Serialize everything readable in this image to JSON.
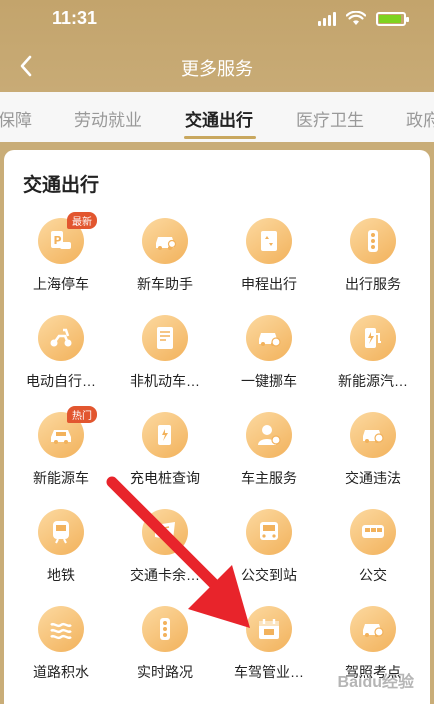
{
  "status_bar": {
    "time": "11:31"
  },
  "header": {
    "title": "更多服务"
  },
  "tabs": [
    {
      "label": "保障",
      "active": false
    },
    {
      "label": "劳动就业",
      "active": false
    },
    {
      "label": "交通出行",
      "active": true
    },
    {
      "label": "医疗卫生",
      "active": false
    },
    {
      "label": "政府",
      "active": false
    }
  ],
  "section": {
    "title": "交通出行"
  },
  "services": [
    {
      "label": "上海停车",
      "icon": "parking-car-icon",
      "badge": "最新"
    },
    {
      "label": "新车助手",
      "icon": "new-car-icon"
    },
    {
      "label": "申程出行",
      "icon": "elevator-icon"
    },
    {
      "label": "出行服务",
      "icon": "traffic-light-icon"
    },
    {
      "label": "电动自行…",
      "icon": "e-scooter-icon"
    },
    {
      "label": "非机动车…",
      "icon": "document-icon"
    },
    {
      "label": "一键挪车",
      "icon": "car-move-icon"
    },
    {
      "label": "新能源汽…",
      "icon": "ev-charge-icon"
    },
    {
      "label": "新能源车",
      "icon": "car-icon",
      "badge": "热门"
    },
    {
      "label": "充电桩查询",
      "icon": "charging-pile-icon"
    },
    {
      "label": "车主服务",
      "icon": "car-owner-icon"
    },
    {
      "label": "交通违法",
      "icon": "violation-car-icon"
    },
    {
      "label": "地铁",
      "icon": "metro-icon"
    },
    {
      "label": "交通卡余…",
      "icon": "card-icon"
    },
    {
      "label": "公交到站",
      "icon": "bus-stop-icon"
    },
    {
      "label": "公交",
      "icon": "bus-icon"
    },
    {
      "label": "道路积水",
      "icon": "water-icon"
    },
    {
      "label": "实时路况",
      "icon": "traffic-light-icon"
    },
    {
      "label": "车驾管业…",
      "icon": "calendar-icon"
    },
    {
      "label": "驾照考点",
      "icon": "license-car-icon"
    }
  ],
  "watermark": "Baidu经验",
  "colors": {
    "header_bg": "#c3a46c",
    "icon_start": "#fcd9a0",
    "icon_end": "#f2b25c",
    "badge": "#e2562f",
    "arrow": "#e8242b"
  }
}
